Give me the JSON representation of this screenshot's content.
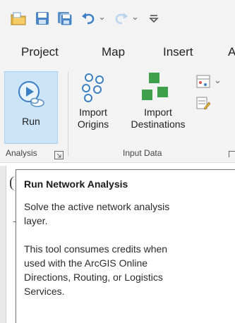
{
  "quick_access": {
    "icons": [
      "open-project-icon",
      "save-icon",
      "save-all-icon",
      "undo-icon",
      "redo-icon",
      "customize-icon"
    ]
  },
  "tabs": [
    {
      "label": "Project"
    },
    {
      "label": "Map"
    },
    {
      "label": "Insert"
    },
    {
      "label": "A"
    }
  ],
  "ribbon": {
    "run_label": "Run",
    "import_origins_line1": "Import",
    "import_origins_line2": "Origins",
    "import_destinations_line1": "Import",
    "import_destinations_line2": "Destinations",
    "analysis_group": "Analysis",
    "input_data_group": "Input Data",
    "run_accent_color": "#cce4f7"
  },
  "tooltip": {
    "title": "Run Network Analysis",
    "description_line1": "Solve the active network analysis",
    "description_line2": "layer.",
    "credits_line1": "This tool consumes credits when",
    "credits_line2": "used with the ArcGIS Online",
    "credits_line3": "Directions, Routing, or Logistics",
    "credits_line4": "Services."
  }
}
